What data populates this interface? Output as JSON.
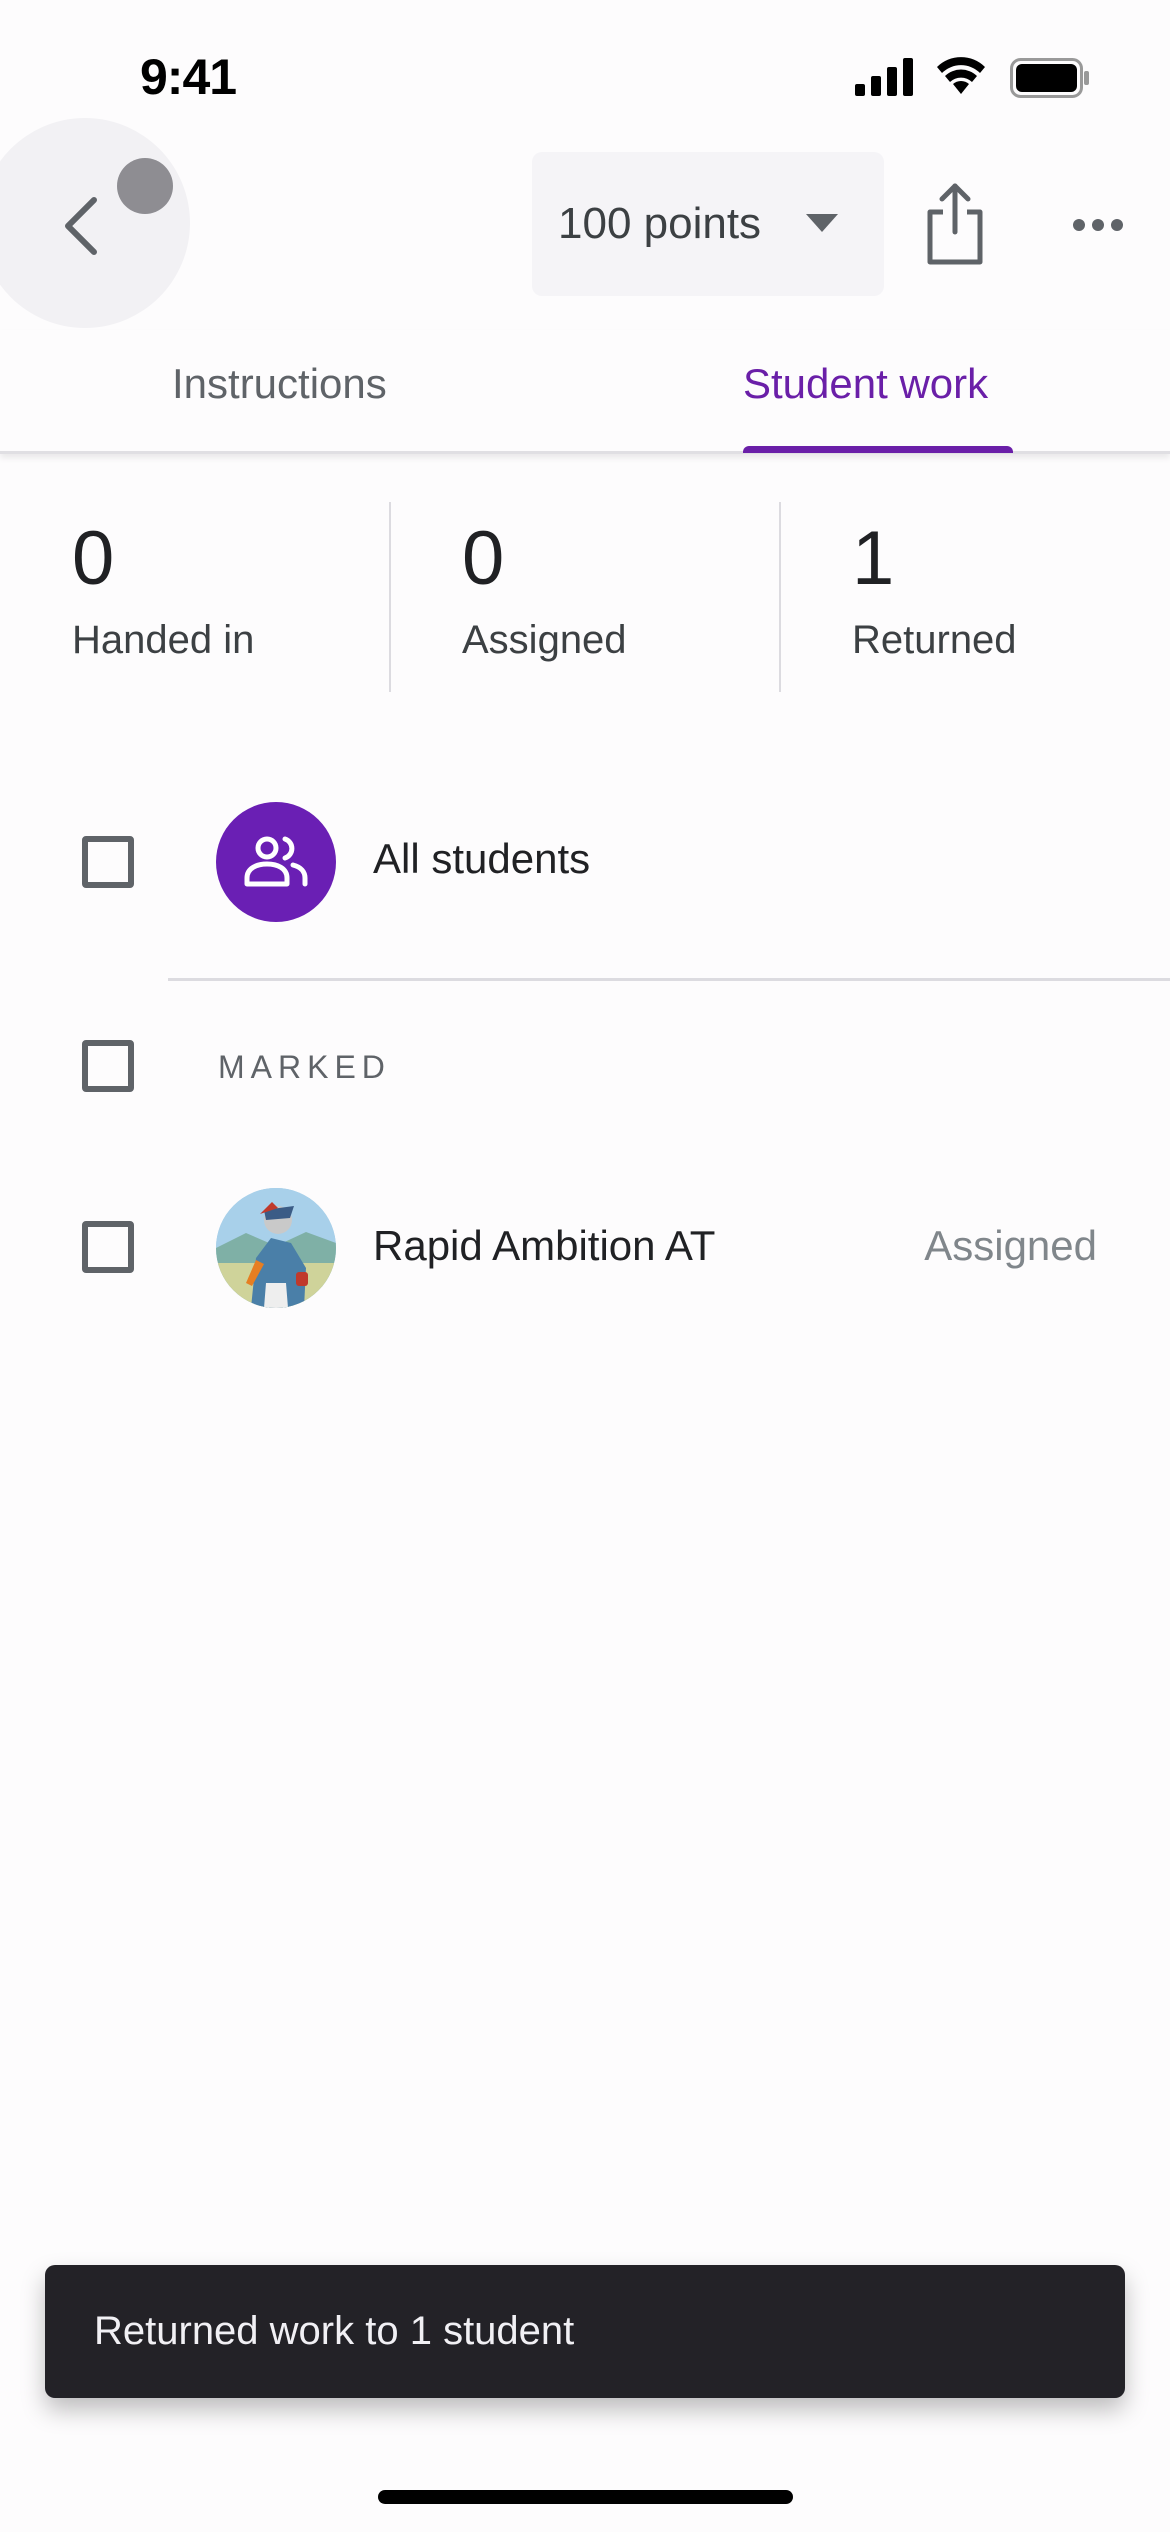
{
  "status_bar": {
    "time": "9:41"
  },
  "top_bar": {
    "back_icon": "chevron-left-icon",
    "points_dropdown": {
      "value": "100 points",
      "icon": "caret-down-icon"
    },
    "share_icon": "share-icon",
    "more_icon": "more-horizontal-icon"
  },
  "tabs": [
    {
      "label": "Instructions",
      "active": false
    },
    {
      "label": "Student work",
      "active": true
    }
  ],
  "stats": [
    {
      "value": "0",
      "label": "Handed in"
    },
    {
      "value": "0",
      "label": "Assigned"
    },
    {
      "value": "1",
      "label": "Returned"
    }
  ],
  "list": {
    "all_students_label": "All students",
    "section_label": "MARKED",
    "students": [
      {
        "name": "Rapid Ambition AT",
        "status": "Assigned"
      }
    ]
  },
  "snackbar": {
    "message": "Returned work to 1 student"
  },
  "colors": {
    "accent": "#6a1fa8",
    "snackbar_bg": "#232227",
    "avatar_group_bg": "#6a1fb4"
  }
}
